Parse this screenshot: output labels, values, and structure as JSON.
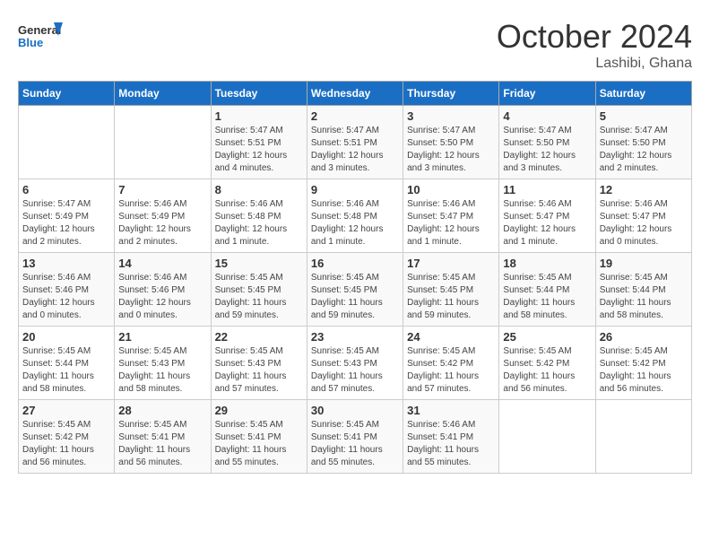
{
  "header": {
    "logo_general": "General",
    "logo_blue": "Blue",
    "month_title": "October 2024",
    "location": "Lashibi, Ghana"
  },
  "days_of_week": [
    "Sunday",
    "Monday",
    "Tuesday",
    "Wednesday",
    "Thursday",
    "Friday",
    "Saturday"
  ],
  "weeks": [
    [
      {
        "day": "",
        "info": ""
      },
      {
        "day": "",
        "info": ""
      },
      {
        "day": "1",
        "info": "Sunrise: 5:47 AM\nSunset: 5:51 PM\nDaylight: 12 hours\nand 4 minutes."
      },
      {
        "day": "2",
        "info": "Sunrise: 5:47 AM\nSunset: 5:51 PM\nDaylight: 12 hours\nand 3 minutes."
      },
      {
        "day": "3",
        "info": "Sunrise: 5:47 AM\nSunset: 5:50 PM\nDaylight: 12 hours\nand 3 minutes."
      },
      {
        "day": "4",
        "info": "Sunrise: 5:47 AM\nSunset: 5:50 PM\nDaylight: 12 hours\nand 3 minutes."
      },
      {
        "day": "5",
        "info": "Sunrise: 5:47 AM\nSunset: 5:50 PM\nDaylight: 12 hours\nand 2 minutes."
      }
    ],
    [
      {
        "day": "6",
        "info": "Sunrise: 5:47 AM\nSunset: 5:49 PM\nDaylight: 12 hours\nand 2 minutes."
      },
      {
        "day": "7",
        "info": "Sunrise: 5:46 AM\nSunset: 5:49 PM\nDaylight: 12 hours\nand 2 minutes."
      },
      {
        "day": "8",
        "info": "Sunrise: 5:46 AM\nSunset: 5:48 PM\nDaylight: 12 hours\nand 1 minute."
      },
      {
        "day": "9",
        "info": "Sunrise: 5:46 AM\nSunset: 5:48 PM\nDaylight: 12 hours\nand 1 minute."
      },
      {
        "day": "10",
        "info": "Sunrise: 5:46 AM\nSunset: 5:47 PM\nDaylight: 12 hours\nand 1 minute."
      },
      {
        "day": "11",
        "info": "Sunrise: 5:46 AM\nSunset: 5:47 PM\nDaylight: 12 hours\nand 1 minute."
      },
      {
        "day": "12",
        "info": "Sunrise: 5:46 AM\nSunset: 5:47 PM\nDaylight: 12 hours\nand 0 minutes."
      }
    ],
    [
      {
        "day": "13",
        "info": "Sunrise: 5:46 AM\nSunset: 5:46 PM\nDaylight: 12 hours\nand 0 minutes."
      },
      {
        "day": "14",
        "info": "Sunrise: 5:46 AM\nSunset: 5:46 PM\nDaylight: 12 hours\nand 0 minutes."
      },
      {
        "day": "15",
        "info": "Sunrise: 5:45 AM\nSunset: 5:45 PM\nDaylight: 11 hours\nand 59 minutes."
      },
      {
        "day": "16",
        "info": "Sunrise: 5:45 AM\nSunset: 5:45 PM\nDaylight: 11 hours\nand 59 minutes."
      },
      {
        "day": "17",
        "info": "Sunrise: 5:45 AM\nSunset: 5:45 PM\nDaylight: 11 hours\nand 59 minutes."
      },
      {
        "day": "18",
        "info": "Sunrise: 5:45 AM\nSunset: 5:44 PM\nDaylight: 11 hours\nand 58 minutes."
      },
      {
        "day": "19",
        "info": "Sunrise: 5:45 AM\nSunset: 5:44 PM\nDaylight: 11 hours\nand 58 minutes."
      }
    ],
    [
      {
        "day": "20",
        "info": "Sunrise: 5:45 AM\nSunset: 5:44 PM\nDaylight: 11 hours\nand 58 minutes."
      },
      {
        "day": "21",
        "info": "Sunrise: 5:45 AM\nSunset: 5:43 PM\nDaylight: 11 hours\nand 58 minutes."
      },
      {
        "day": "22",
        "info": "Sunrise: 5:45 AM\nSunset: 5:43 PM\nDaylight: 11 hours\nand 57 minutes."
      },
      {
        "day": "23",
        "info": "Sunrise: 5:45 AM\nSunset: 5:43 PM\nDaylight: 11 hours\nand 57 minutes."
      },
      {
        "day": "24",
        "info": "Sunrise: 5:45 AM\nSunset: 5:42 PM\nDaylight: 11 hours\nand 57 minutes."
      },
      {
        "day": "25",
        "info": "Sunrise: 5:45 AM\nSunset: 5:42 PM\nDaylight: 11 hours\nand 56 minutes."
      },
      {
        "day": "26",
        "info": "Sunrise: 5:45 AM\nSunset: 5:42 PM\nDaylight: 11 hours\nand 56 minutes."
      }
    ],
    [
      {
        "day": "27",
        "info": "Sunrise: 5:45 AM\nSunset: 5:42 PM\nDaylight: 11 hours\nand 56 minutes."
      },
      {
        "day": "28",
        "info": "Sunrise: 5:45 AM\nSunset: 5:41 PM\nDaylight: 11 hours\nand 56 minutes."
      },
      {
        "day": "29",
        "info": "Sunrise: 5:45 AM\nSunset: 5:41 PM\nDaylight: 11 hours\nand 55 minutes."
      },
      {
        "day": "30",
        "info": "Sunrise: 5:45 AM\nSunset: 5:41 PM\nDaylight: 11 hours\nand 55 minutes."
      },
      {
        "day": "31",
        "info": "Sunrise: 5:46 AM\nSunset: 5:41 PM\nDaylight: 11 hours\nand 55 minutes."
      },
      {
        "day": "",
        "info": ""
      },
      {
        "day": "",
        "info": ""
      }
    ]
  ]
}
